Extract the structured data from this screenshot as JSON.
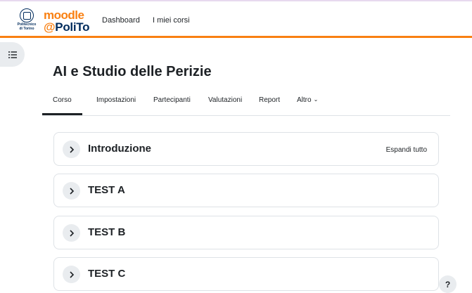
{
  "header": {
    "logo_polito_lines": [
      "Politecnico",
      "di Torino"
    ],
    "logo_moodle_top": "moodle",
    "logo_moodle_at": "@",
    "logo_moodle_bottom": "PoliTo",
    "nav": [
      {
        "label": "Dashboard"
      },
      {
        "label": "I miei corsi"
      }
    ],
    "accent_color": "#f98012"
  },
  "drawer": {
    "icon": "list-icon"
  },
  "course": {
    "title": "AI e Studio delle Perizie"
  },
  "tabs": [
    {
      "label": "Corso",
      "active": true
    },
    {
      "label": "Impostazioni"
    },
    {
      "label": "Partecipanti"
    },
    {
      "label": "Valutazioni"
    },
    {
      "label": "Report"
    },
    {
      "label": "Altro",
      "icon": "chevron-down-icon"
    }
  ],
  "sections": [
    {
      "name": "Introduzione",
      "expand_all_label": "Espandi tutto"
    },
    {
      "name": "TEST A"
    },
    {
      "name": "TEST B"
    },
    {
      "name": "TEST C"
    }
  ],
  "help": {
    "label": "?"
  }
}
